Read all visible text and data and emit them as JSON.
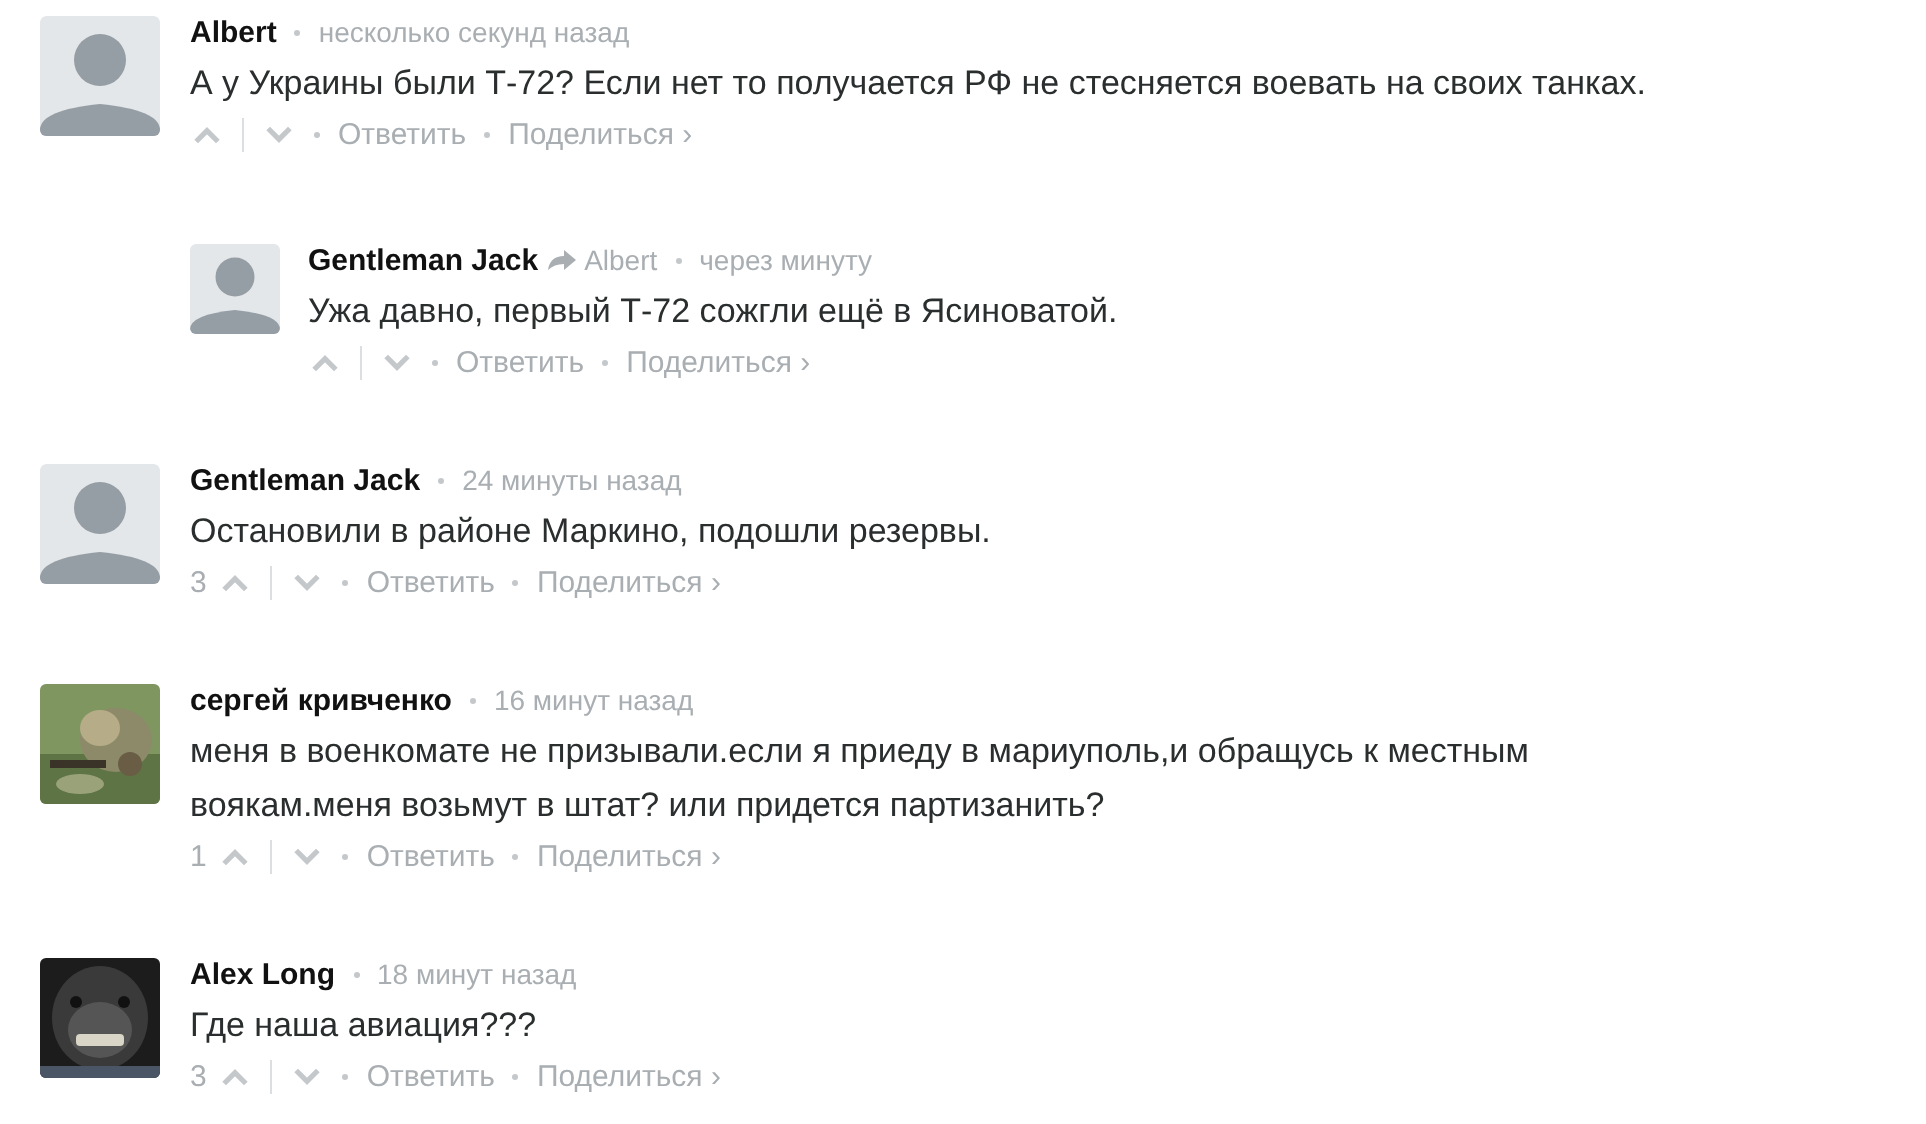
{
  "comments": [
    {
      "author": "Albert",
      "time": "несколько секунд назад",
      "text": "А у Украины были Т-72? Если нет то получается РФ не стесняется воевать на своих танках.",
      "avatar": {
        "kind": "default"
      },
      "reply": "Ответить",
      "share": "Поделиться ›",
      "children": [
        {
          "author": "Gentleman Jack",
          "reply_to": "Albert",
          "time": "через минуту",
          "text": "Ужа давно, первый Т-72 сожгли ещё в Ясиноватой.",
          "avatar": {
            "kind": "default"
          },
          "reply": "Ответить",
          "share": "Поделиться ›"
        }
      ]
    },
    {
      "author": "Gentleman Jack",
      "time": "24 минуты назад",
      "text": "Остановили в районе Маркино, подошли резервы.",
      "avatar": {
        "kind": "default"
      },
      "votes": "3",
      "reply": "Ответить",
      "share": "Поделиться ›"
    },
    {
      "author": "сергей кривченко",
      "time": "16 минут назад",
      "text": "меня в военкомате не призывали.если я приеду в мариуполь,и обращусь к местным воякам.меня возьмут в штат? или придется партизанить?",
      "votes": "1",
      "reply": "Ответить",
      "share": "Поделиться ›"
    },
    {
      "author": "Alex Long",
      "time": "18 минут назад",
      "text": "Где наша авиация???",
      "votes": "3",
      "reply": "Ответить",
      "share": "Поделиться ›"
    }
  ]
}
